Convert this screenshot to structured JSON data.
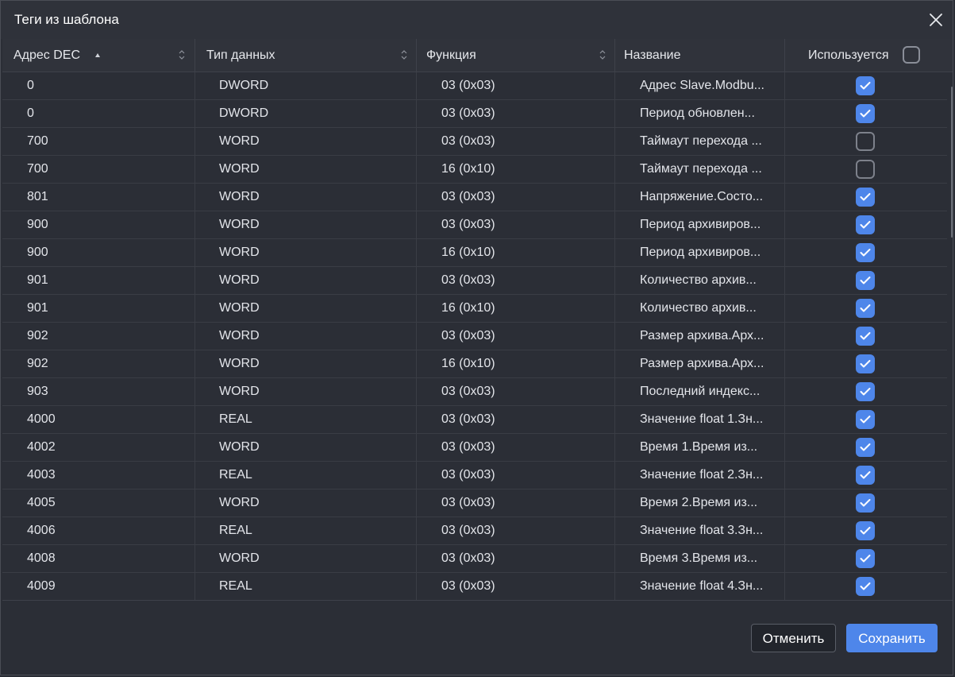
{
  "dialog": {
    "title": "Теги из шаблона",
    "close_icon": "close-icon"
  },
  "columns": [
    {
      "label": "Адрес DEC",
      "sorted": "asc"
    },
    {
      "label": "Тип данных"
    },
    {
      "label": "Функция"
    },
    {
      "label": "Название"
    },
    {
      "label": "Используется"
    }
  ],
  "select_all_checked": false,
  "rows": [
    {
      "address": "0",
      "type": "DWORD",
      "function": "03 (0x03)",
      "name": "Адрес Slave.Modbu...",
      "used": true
    },
    {
      "address": "0",
      "type": "DWORD",
      "function": "03 (0x03)",
      "name": "Период обновлен...",
      "used": true
    },
    {
      "address": "700",
      "type": "WORD",
      "function": "03 (0x03)",
      "name": "Таймаут перехода ...",
      "used": false
    },
    {
      "address": "700",
      "type": "WORD",
      "function": "16 (0x10)",
      "name": "Таймаут перехода ...",
      "used": false
    },
    {
      "address": "801",
      "type": "WORD",
      "function": "03 (0x03)",
      "name": "Напряжение.Состо...",
      "used": true
    },
    {
      "address": "900",
      "type": "WORD",
      "function": "03 (0x03)",
      "name": "Период архивиров...",
      "used": true
    },
    {
      "address": "900",
      "type": "WORD",
      "function": "16 (0x10)",
      "name": "Период архивиров...",
      "used": true
    },
    {
      "address": "901",
      "type": "WORD",
      "function": "03 (0x03)",
      "name": "Количество архив...",
      "used": true
    },
    {
      "address": "901",
      "type": "WORD",
      "function": "16 (0x10)",
      "name": "Количество архив...",
      "used": true
    },
    {
      "address": "902",
      "type": "WORD",
      "function": "03 (0x03)",
      "name": "Размер архива.Арх...",
      "used": true
    },
    {
      "address": "902",
      "type": "WORD",
      "function": "16 (0x10)",
      "name": "Размер архива.Арх...",
      "used": true
    },
    {
      "address": "903",
      "type": "WORD",
      "function": "03 (0x03)",
      "name": "Последний индекс...",
      "used": true
    },
    {
      "address": "4000",
      "type": "REAL",
      "function": "03 (0x03)",
      "name": "Значение float 1.Зн...",
      "used": true
    },
    {
      "address": "4002",
      "type": "WORD",
      "function": "03 (0x03)",
      "name": "Время 1.Время из...",
      "used": true
    },
    {
      "address": "4003",
      "type": "REAL",
      "function": "03 (0x03)",
      "name": "Значение float 2.Зн...",
      "used": true
    },
    {
      "address": "4005",
      "type": "WORD",
      "function": "03 (0x03)",
      "name": "Время 2.Время из...",
      "used": true
    },
    {
      "address": "4006",
      "type": "REAL",
      "function": "03 (0x03)",
      "name": "Значение float 3.Зн...",
      "used": true
    },
    {
      "address": "4008",
      "type": "WORD",
      "function": "03 (0x03)",
      "name": "Время 3.Время из...",
      "used": true
    },
    {
      "address": "4009",
      "type": "REAL",
      "function": "03 (0x03)",
      "name": "Значение float 4.Зн...",
      "used": true
    }
  ],
  "footer": {
    "cancel_label": "Отменить",
    "save_label": "Сохранить"
  },
  "colors": {
    "accent": "#4e86ea",
    "background": "#2b2e36"
  }
}
